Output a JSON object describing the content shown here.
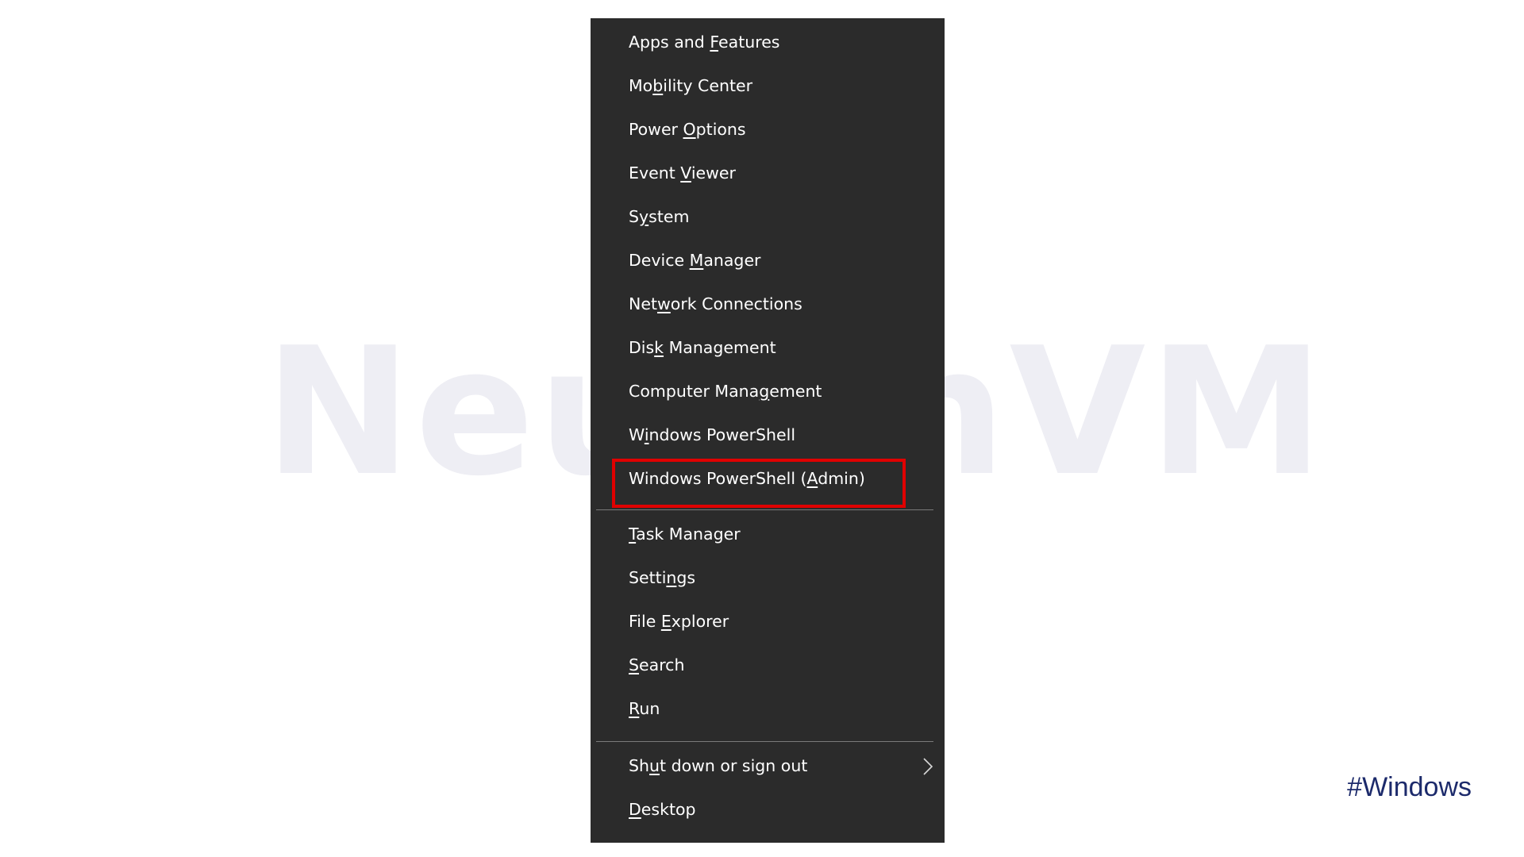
{
  "watermark": {
    "text": "NeuronVM"
  },
  "menu": {
    "items": [
      {
        "pre": "Apps and ",
        "u": "F",
        "post": "eatures"
      },
      {
        "pre": "Mo",
        "u": "b",
        "post": "ility Center"
      },
      {
        "pre": "Power ",
        "u": "O",
        "post": "ptions"
      },
      {
        "pre": "Event ",
        "u": "V",
        "post": "iewer"
      },
      {
        "pre": "S",
        "u": "y",
        "post": "stem"
      },
      {
        "pre": "Device ",
        "u": "M",
        "post": "anager"
      },
      {
        "pre": "Net",
        "u": "w",
        "post": "ork Connections"
      },
      {
        "pre": "Dis",
        "u": "k",
        "post": " Management"
      },
      {
        "pre": "Computer Mana",
        "u": "g",
        "post": "ement"
      },
      {
        "pre": "W",
        "u": "i",
        "post": "ndows PowerShell"
      },
      {
        "pre": "Windows PowerShell (",
        "u": "A",
        "post": "dmin)"
      },
      {
        "pre": "",
        "u": "T",
        "post": "ask Manager"
      },
      {
        "pre": "Setti",
        "u": "n",
        "post": "gs"
      },
      {
        "pre": "File ",
        "u": "E",
        "post": "xplorer"
      },
      {
        "pre": "",
        "u": "S",
        "post": "earch"
      },
      {
        "pre": "",
        "u": "R",
        "post": "un"
      },
      {
        "pre": "Sh",
        "u": "u",
        "post": "t down or sign out"
      },
      {
        "pre": "",
        "u": "D",
        "post": "esktop"
      }
    ],
    "highlighted_item": "Windows PowerShell (Admin)",
    "submenu_icon": "chevron-right-icon"
  },
  "hashtag": "#Windows",
  "colors": {
    "menu_background": "#2b2b2b",
    "menu_text": "#ffffff",
    "highlight_border": "#e00000",
    "hashtag": "#1c2a6b",
    "watermark": "#eeeef4"
  }
}
